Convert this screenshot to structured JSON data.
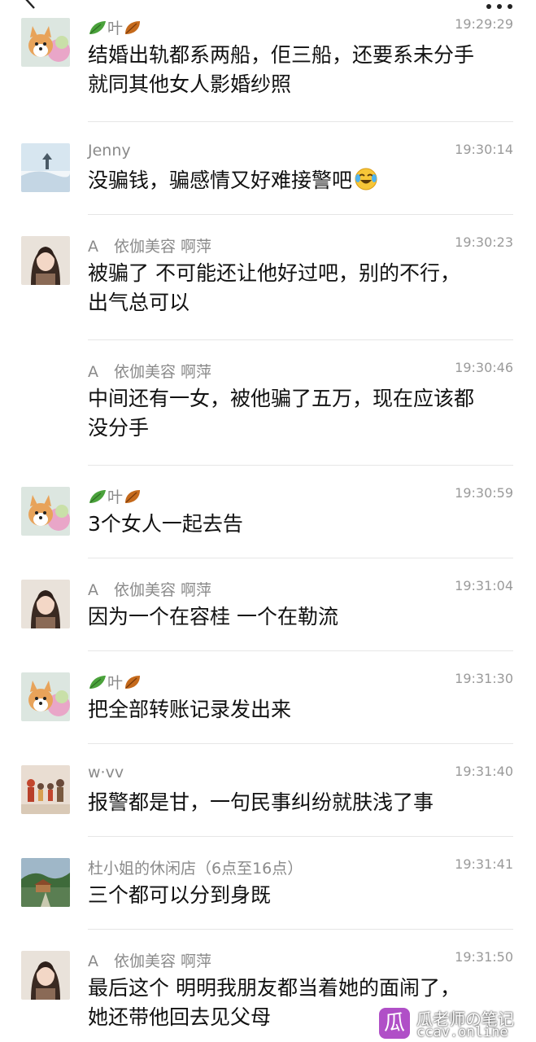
{
  "colors": {
    "divider": "#e6e6e6",
    "name": "#8a8a8a",
    "time": "#9a9a9a",
    "text": "#111111"
  },
  "topbar": {
    "back_icon": "chevron-left-icon",
    "more_icon": "ellipsis-icon"
  },
  "messages": [
    {
      "avatar": "dog-avatar",
      "sender": "叶",
      "time": "19:29:29",
      "text": "结婚出轨都系两船，佢三船，还要系未分手\n就同其他女人影婚纱照"
    },
    {
      "avatar": "snow-lake-avatar",
      "sender": "Jenny",
      "time": "19:30:14",
      "text": "没骗钱，骗感情又好难接警吧"
    },
    {
      "avatar": "girl-avatar",
      "sender": "A　依伽美容 啊萍",
      "time": "19:30:23",
      "text": "被骗了 不可能还让他好过吧，别的不行，\n出气总可以"
    },
    {
      "avatar": "",
      "sender": "A　依伽美容 啊萍",
      "time": "19:30:46",
      "text": "中间还有一女，被他骗了五万，现在应该都\n没分手"
    },
    {
      "avatar": "dog-avatar",
      "sender": "叶",
      "time": "19:30:59",
      "text": "3个女人一起去告"
    },
    {
      "avatar": "girl-avatar",
      "sender": "A　依伽美容 啊萍",
      "time": "19:31:04",
      "text": "因为一个在容桂 一个在勒流"
    },
    {
      "avatar": "dog-avatar",
      "sender": "叶",
      "time": "19:31:30",
      "text": "把全部转账记录发出来"
    },
    {
      "avatar": "family-avatar",
      "sender": "w·vv",
      "time": "19:31:40",
      "text": "报警都是甘，一句民事纠纷就肤浅了事"
    },
    {
      "avatar": "landscape-avatar",
      "sender": "杜小姐的休闲店（6点至16点）",
      "time": "19:31:41",
      "text": "三个都可以分到身既"
    },
    {
      "avatar": "girl-avatar",
      "sender": "A　依伽美容 啊萍",
      "time": "19:31:50",
      "text": "最后这个 明明我朋友都当着她的面闹了，\n她还带他回去见父母"
    }
  ],
  "watermark": {
    "logo": "瓜",
    "title": "瓜老师の笔记",
    "url": "ccav.online"
  }
}
